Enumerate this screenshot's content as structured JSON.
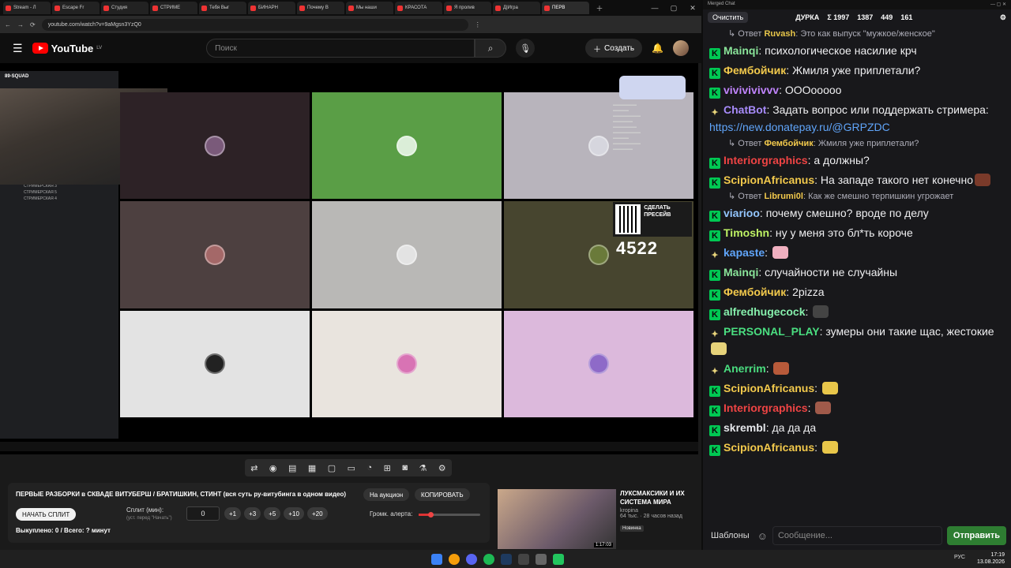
{
  "browser": {
    "tabs": [
      "Stream - Л",
      "Escape Fr",
      "Студия",
      "СТРИМЕ",
      "Тебя Выг",
      "БИНАРН",
      "Почему В",
      "Мы наши",
      "КРАСОТА",
      "Я пролив",
      "Д|Игра",
      "ПЕРВ"
    ],
    "url": "youtube.com/watch?v=9aMgsn3YzQ0"
  },
  "youtube": {
    "logo": "YouTube",
    "region": "LV",
    "search_placeholder": "Поиск",
    "create_label": "Создать"
  },
  "stream_overlay": {
    "discord_server": "89-SQUAD",
    "channels": [
      "СТРИМЕРСКАЯ 2",
      "СТРИМЕРСКАЯ 3",
      "СТРИМЕРСКАЯ 5",
      "СТРИМЕРСКАЯ 4"
    ],
    "presev_title": "СДЕЛАТЬ ПРЕСЕЙВ",
    "counter": "4522",
    "grid_colors": [
      "#2d2226",
      "#5a9e46",
      "#b8b4bc",
      "#4d4040",
      "#b9b8b6",
      "#47452f",
      "#e3e3e3",
      "#e9e4de",
      "#dcb9dc"
    ],
    "grid_icons": [
      "#7a5a7a",
      "#dbeed8",
      "#d6d6de",
      "#a46868",
      "#e3e3e3",
      "#6a7a3a",
      "#222222",
      "#d873b4",
      "#8e6ac8"
    ]
  },
  "controls": {
    "video_title": "ПЕРВЫЕ РАЗБОРКИ в СКВАДЕ ВИТУБЕРШ / БРАТИШКИН, СТИНТ (вся суть ру-витубинга в одном видео)",
    "auction_btn": "На аукцион",
    "copy_btn": "КОПИРОВАТЬ",
    "split_btn": "НАЧАТЬ СПЛИТ",
    "split_label": "Сплит (мин):",
    "split_hint": "(уст. перед \"Начать\")",
    "split_value": "0",
    "increments": [
      "+1",
      "+3",
      "+5",
      "+10",
      "+20"
    ],
    "alert_label": "Громк. алерта:",
    "bought": "Выкуплено: 0 / Всего: ? минут"
  },
  "recommended": {
    "title": "ЛУКСМАКСИКИ И ИХ СИСТЕМА МИРА",
    "channel": "kropina",
    "stats": "64 тыс. · 28 часов назад",
    "badge": "Новинка",
    "duration": "1:17:03"
  },
  "chat": {
    "window_title": "Merged Chat",
    "clear_label": "Очистить",
    "team": "ДУРКА",
    "stats": [
      "Σ 1997",
      "1387",
      "449",
      "161"
    ],
    "templates_label": "Шаблоны",
    "input_placeholder": "Сообщение...",
    "send_label": "Отправить",
    "messages": [
      {
        "type": "reply",
        "nick": "Ruvash",
        "text": "Это как выпуск \"мужкое/женское\"",
        "color": "#e8c64a"
      },
      {
        "type": "msg",
        "badge": "K",
        "nick": "Mainqi",
        "text": "психологическое насилие крч",
        "color": "#8ae59a"
      },
      {
        "type": "msg",
        "badge": "K",
        "nick": "Фембойчик",
        "text": "Жмиля уже приплетали?",
        "color": "#f2c94c"
      },
      {
        "type": "msg",
        "badge": "K",
        "nick": "vivivivivvv",
        "text": "ОООооооо",
        "color": "#c084fc"
      },
      {
        "type": "msg",
        "badge": "bee",
        "nick": "ChatBot",
        "text": "Задать вопрос или поддержать стримера:",
        "link": "https://new.donatepay.ru/@GRPZDC",
        "color": "#a78bfa"
      },
      {
        "type": "reply",
        "nick": "Фембойчик",
        "text": "Жмиля уже приплетали?",
        "color": "#f2c94c"
      },
      {
        "type": "msg",
        "badge": "K",
        "nick": "Interiorgraphics",
        "text": "а должны?",
        "color": "#ef4444"
      },
      {
        "type": "msg",
        "badge": "K",
        "nick": "ScipionAfricanus",
        "text": "На западе такого нет конечно",
        "color": "#f2c94c",
        "emote": "#7a3a2a"
      },
      {
        "type": "reply",
        "nick": "Librumi0l",
        "text": "Как же смешно терпишкин угрожает",
        "color": "#f2c94c"
      },
      {
        "type": "msg",
        "badge": "K",
        "nick": "viarioo",
        "text": "почему смешно? вроде по делу",
        "color": "#93c5fd"
      },
      {
        "type": "msg",
        "badge": "K",
        "nick": "Timoshn",
        "text": "ну у меня это бл*ть короче",
        "color": "#bef264"
      },
      {
        "type": "msg",
        "badge": "bee",
        "nick": "kapaste",
        "text": "",
        "color": "#60a5fa",
        "emote": "#f0b0c0"
      },
      {
        "type": "msg",
        "badge": "K",
        "nick": "Mainqi",
        "text": "случайности не случайны",
        "color": "#8ae59a"
      },
      {
        "type": "msg",
        "badge": "K",
        "nick": "Фембойчик",
        "text": "2pizza",
        "color": "#f2c94c"
      },
      {
        "type": "msg",
        "badge": "K",
        "nick": "alfredhugecock",
        "text": "",
        "color": "#86efac",
        "emote": "#444444"
      },
      {
        "type": "msg",
        "badge": "bee",
        "nick": "PERSONAL_PLAY",
        "text": "зумеры они такие щас, жестокие",
        "color": "#4ade80",
        "emote": "#e6d27a"
      },
      {
        "type": "msg",
        "badge": "bee",
        "nick": "Anerrim",
        "text": "",
        "color": "#4ade80",
        "emote": "#b85a3a"
      },
      {
        "type": "msg",
        "badge": "K",
        "nick": "ScipionAfricanus",
        "text": "",
        "color": "#f2c94c",
        "emote": "#e8c64a"
      },
      {
        "type": "msg",
        "badge": "K",
        "nick": "Interiorgraphics",
        "text": "",
        "color": "#ef4444",
        "emote": "#a05a4a"
      },
      {
        "type": "msg",
        "badge": "K",
        "nick": "skrembl",
        "text": "да да да",
        "color": "#e5e7eb"
      },
      {
        "type": "msg",
        "badge": "K",
        "nick": "ScipionAfricanus",
        "text": "",
        "color": "#f2c94c",
        "emote": "#e8c64a"
      }
    ]
  },
  "taskbar": {
    "lang": "РУС",
    "time": "17:19",
    "date": "13.08.2026"
  }
}
